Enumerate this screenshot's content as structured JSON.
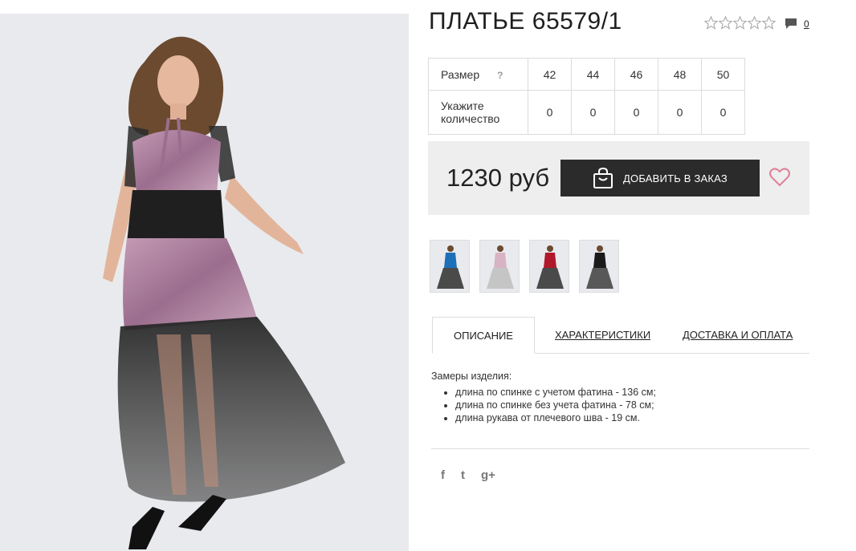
{
  "product": {
    "title": "ПЛАТЬЕ 65579/1",
    "rating": {
      "value": 0,
      "max": 5
    },
    "comments_count": "0"
  },
  "size_table": {
    "size_label": "Размер",
    "help_label": "?",
    "quantity_label_line1": "Укажите",
    "quantity_label_line2": "количество",
    "sizes": [
      "42",
      "44",
      "46",
      "48",
      "50"
    ],
    "quantities": [
      "0",
      "0",
      "0",
      "0",
      "0"
    ]
  },
  "purchase": {
    "price": "1230 руб",
    "add_button_label": "ДОБАВИТЬ В ЗАКАЗ"
  },
  "thumbnails": [
    {
      "name": "blue",
      "color": "#1d6fb8"
    },
    {
      "name": "pink",
      "color": "#d8b3c4"
    },
    {
      "name": "red",
      "color": "#b0182b"
    },
    {
      "name": "black",
      "color": "#1a1a1a"
    }
  ],
  "tabs": {
    "description": "ОПИСАНИЕ",
    "characteristics": "ХАРАКТЕРИСТИКИ",
    "delivery": "ДОСТАВКА И ОПЛАТА",
    "active": "description"
  },
  "description": {
    "lead": "Замеры изделия:",
    "items": [
      "длина по спинке с учетом фатина - 136 см;",
      "длина по спинке без учета фатина - 78 см;",
      "длина рукава от плечевого шва - 19 см."
    ]
  },
  "social": {
    "facebook": "f",
    "twitter": "t",
    "googleplus": "g+"
  },
  "colors": {
    "accent_heart": "#e07f98",
    "button_bg": "#2b2b2b",
    "panel_bg": "#eeeeee",
    "dress_velvet": "#a87a9c"
  }
}
